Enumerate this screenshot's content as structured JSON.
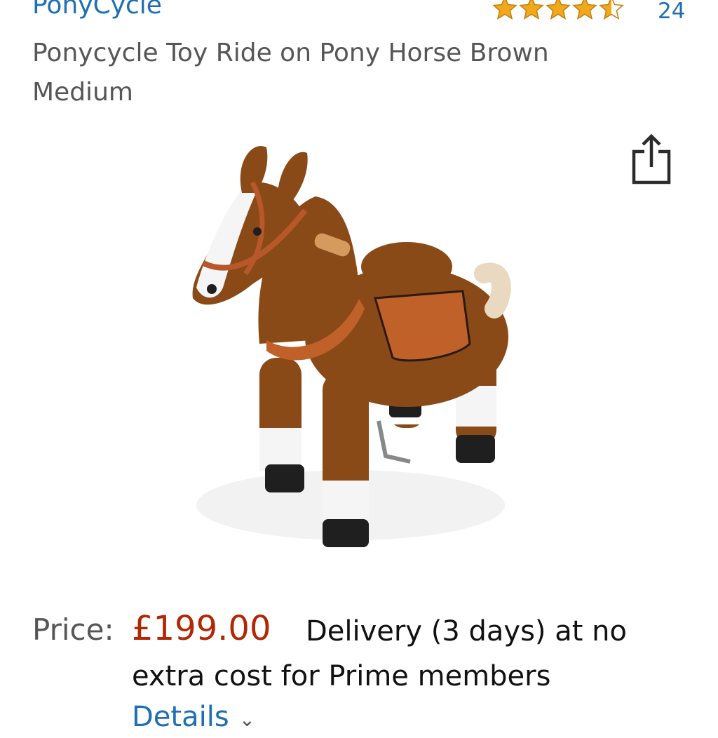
{
  "brand": "PonyCycle",
  "rating": {
    "stars": 4.5,
    "out_of": 5,
    "count": "24"
  },
  "product": {
    "title": "Ponycycle Toy Ride on Pony Horse Brown Medium",
    "image_icon": "pony-toy-image"
  },
  "share": {
    "icon": "share-icon"
  },
  "price": {
    "label": "Price:",
    "value": "£199.00",
    "delivery": "Delivery (3 days) at no extra cost for Prime members",
    "details_link": "Details",
    "details_chevron": "⌄"
  },
  "colors": {
    "link": "#1f6fb2",
    "price": "#b12704",
    "star": "#f0a81c",
    "text_muted": "#565656"
  }
}
